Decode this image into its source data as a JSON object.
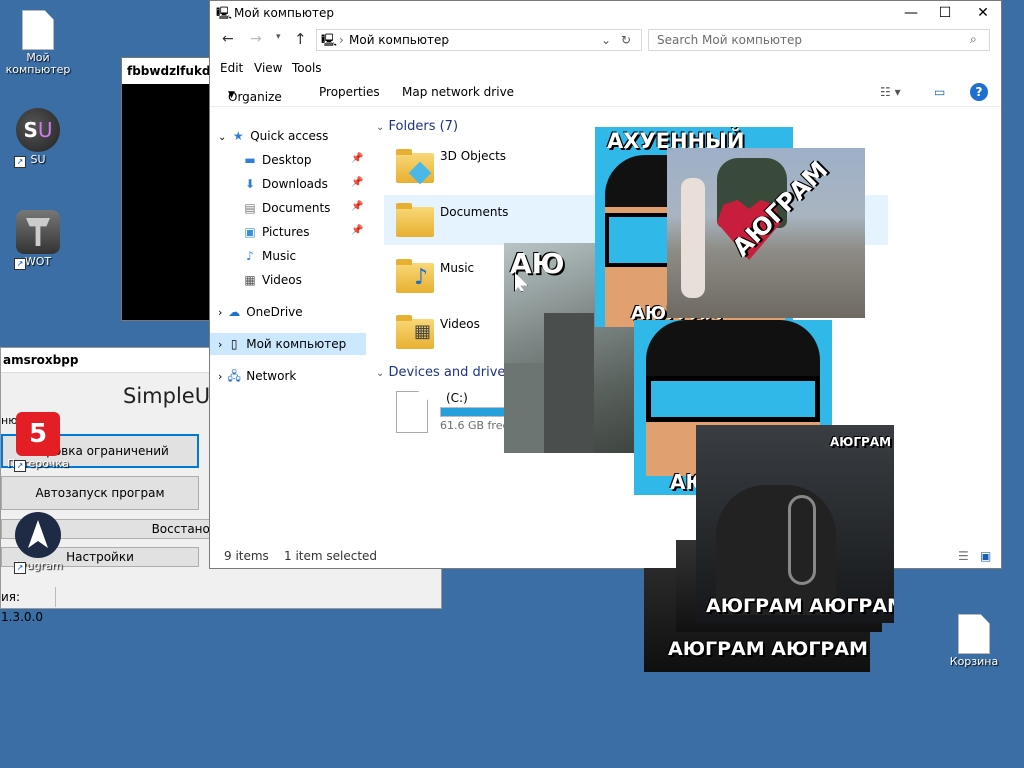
{
  "desktop": {
    "icons": [
      {
        "label": "Мой компьютер"
      },
      {
        "label": "SU"
      },
      {
        "label": "WOT"
      },
      {
        "label": "Пятерочка"
      },
      {
        "label": "Ayugram"
      },
      {
        "label": "Корзина"
      }
    ],
    "su_glyph_s": "S",
    "su_glyph_u": "U",
    "p5_glyph": "5"
  },
  "black_window": {
    "title": "fbbwdzlfukdkie"
  },
  "simple_window": {
    "title": "amsroxbpp",
    "app_name": "SimpleUn",
    "side_label": "ню",
    "buttons": [
      "кировка ограничений",
      "Автозапуск програм",
      "Восстановле",
      "Настройки"
    ],
    "version": "ия: 1.3.0.0"
  },
  "explorer": {
    "title": "Мой компьютер",
    "address": "Мой компьютер",
    "search_placeholder": "Search Мой компьютер",
    "menu": [
      "Edit",
      "View",
      "Tools"
    ],
    "commands": [
      "Organize",
      "Properties",
      "Map network drive"
    ],
    "nav": {
      "quick_access": "Quick access",
      "items": [
        "Desktop",
        "Downloads",
        "Documents",
        "Pictures",
        "Music",
        "Videos"
      ],
      "onedrive": "OneDrive",
      "this_pc": "Мой компьютер",
      "network": "Network"
    },
    "folders_header": "Folders (7)",
    "folders": [
      "3D Objects",
      "Documents",
      "Music",
      "Videos"
    ],
    "devices_header": "Devices and drives",
    "drive": {
      "name": "(C:)",
      "free": "61.6 GB free",
      "usage_fraction": 0.55
    },
    "status": {
      "items": "9 items",
      "selected": "1 item selected"
    }
  },
  "memes": {
    "top_text": "АХУЕННЫЙ",
    "brand_a": "АЮ",
    "brand_b": "ГРАМ",
    "small_brand": "АЮ",
    "small_brand_b": "ГРАМ"
  },
  "colors": {
    "desktop_bg": "#3a6ea5",
    "accent_blue": "#0078d7",
    "meme_cyan": "#2fb8e8",
    "selection": "#cce8ff"
  }
}
